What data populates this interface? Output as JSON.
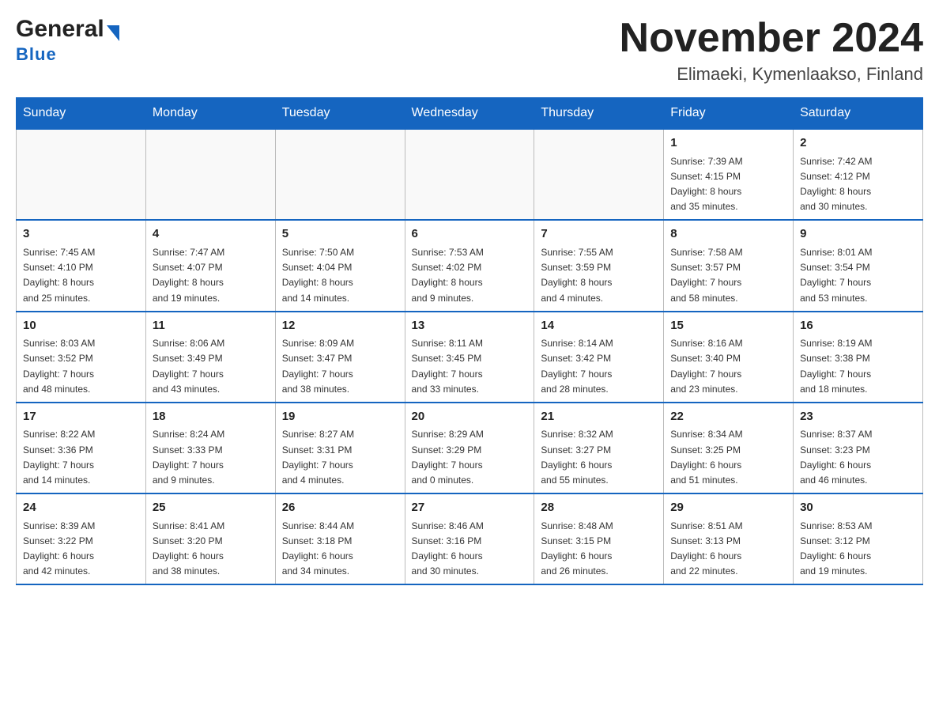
{
  "header": {
    "logo_general": "General",
    "logo_blue": "Blue",
    "title": "November 2024",
    "subtitle": "Elimaeki, Kymenlaakso, Finland"
  },
  "weekdays": [
    "Sunday",
    "Monday",
    "Tuesday",
    "Wednesday",
    "Thursday",
    "Friday",
    "Saturday"
  ],
  "weeks": [
    [
      {
        "day": "",
        "info": ""
      },
      {
        "day": "",
        "info": ""
      },
      {
        "day": "",
        "info": ""
      },
      {
        "day": "",
        "info": ""
      },
      {
        "day": "",
        "info": ""
      },
      {
        "day": "1",
        "info": "Sunrise: 7:39 AM\nSunset: 4:15 PM\nDaylight: 8 hours\nand 35 minutes."
      },
      {
        "day": "2",
        "info": "Sunrise: 7:42 AM\nSunset: 4:12 PM\nDaylight: 8 hours\nand 30 minutes."
      }
    ],
    [
      {
        "day": "3",
        "info": "Sunrise: 7:45 AM\nSunset: 4:10 PM\nDaylight: 8 hours\nand 25 minutes."
      },
      {
        "day": "4",
        "info": "Sunrise: 7:47 AM\nSunset: 4:07 PM\nDaylight: 8 hours\nand 19 minutes."
      },
      {
        "day": "5",
        "info": "Sunrise: 7:50 AM\nSunset: 4:04 PM\nDaylight: 8 hours\nand 14 minutes."
      },
      {
        "day": "6",
        "info": "Sunrise: 7:53 AM\nSunset: 4:02 PM\nDaylight: 8 hours\nand 9 minutes."
      },
      {
        "day": "7",
        "info": "Sunrise: 7:55 AM\nSunset: 3:59 PM\nDaylight: 8 hours\nand 4 minutes."
      },
      {
        "day": "8",
        "info": "Sunrise: 7:58 AM\nSunset: 3:57 PM\nDaylight: 7 hours\nand 58 minutes."
      },
      {
        "day": "9",
        "info": "Sunrise: 8:01 AM\nSunset: 3:54 PM\nDaylight: 7 hours\nand 53 minutes."
      }
    ],
    [
      {
        "day": "10",
        "info": "Sunrise: 8:03 AM\nSunset: 3:52 PM\nDaylight: 7 hours\nand 48 minutes."
      },
      {
        "day": "11",
        "info": "Sunrise: 8:06 AM\nSunset: 3:49 PM\nDaylight: 7 hours\nand 43 minutes."
      },
      {
        "day": "12",
        "info": "Sunrise: 8:09 AM\nSunset: 3:47 PM\nDaylight: 7 hours\nand 38 minutes."
      },
      {
        "day": "13",
        "info": "Sunrise: 8:11 AM\nSunset: 3:45 PM\nDaylight: 7 hours\nand 33 minutes."
      },
      {
        "day": "14",
        "info": "Sunrise: 8:14 AM\nSunset: 3:42 PM\nDaylight: 7 hours\nand 28 minutes."
      },
      {
        "day": "15",
        "info": "Sunrise: 8:16 AM\nSunset: 3:40 PM\nDaylight: 7 hours\nand 23 minutes."
      },
      {
        "day": "16",
        "info": "Sunrise: 8:19 AM\nSunset: 3:38 PM\nDaylight: 7 hours\nand 18 minutes."
      }
    ],
    [
      {
        "day": "17",
        "info": "Sunrise: 8:22 AM\nSunset: 3:36 PM\nDaylight: 7 hours\nand 14 minutes."
      },
      {
        "day": "18",
        "info": "Sunrise: 8:24 AM\nSunset: 3:33 PM\nDaylight: 7 hours\nand 9 minutes."
      },
      {
        "day": "19",
        "info": "Sunrise: 8:27 AM\nSunset: 3:31 PM\nDaylight: 7 hours\nand 4 minutes."
      },
      {
        "day": "20",
        "info": "Sunrise: 8:29 AM\nSunset: 3:29 PM\nDaylight: 7 hours\nand 0 minutes."
      },
      {
        "day": "21",
        "info": "Sunrise: 8:32 AM\nSunset: 3:27 PM\nDaylight: 6 hours\nand 55 minutes."
      },
      {
        "day": "22",
        "info": "Sunrise: 8:34 AM\nSunset: 3:25 PM\nDaylight: 6 hours\nand 51 minutes."
      },
      {
        "day": "23",
        "info": "Sunrise: 8:37 AM\nSunset: 3:23 PM\nDaylight: 6 hours\nand 46 minutes."
      }
    ],
    [
      {
        "day": "24",
        "info": "Sunrise: 8:39 AM\nSunset: 3:22 PM\nDaylight: 6 hours\nand 42 minutes."
      },
      {
        "day": "25",
        "info": "Sunrise: 8:41 AM\nSunset: 3:20 PM\nDaylight: 6 hours\nand 38 minutes."
      },
      {
        "day": "26",
        "info": "Sunrise: 8:44 AM\nSunset: 3:18 PM\nDaylight: 6 hours\nand 34 minutes."
      },
      {
        "day": "27",
        "info": "Sunrise: 8:46 AM\nSunset: 3:16 PM\nDaylight: 6 hours\nand 30 minutes."
      },
      {
        "day": "28",
        "info": "Sunrise: 8:48 AM\nSunset: 3:15 PM\nDaylight: 6 hours\nand 26 minutes."
      },
      {
        "day": "29",
        "info": "Sunrise: 8:51 AM\nSunset: 3:13 PM\nDaylight: 6 hours\nand 22 minutes."
      },
      {
        "day": "30",
        "info": "Sunrise: 8:53 AM\nSunset: 3:12 PM\nDaylight: 6 hours\nand 19 minutes."
      }
    ]
  ]
}
